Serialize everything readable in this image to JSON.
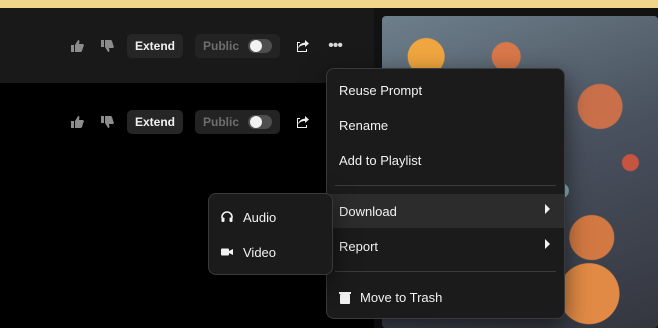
{
  "track_rows": [
    {
      "extend_label": "Extend",
      "public_label": "Public",
      "icons": {
        "like": "thumb-up-icon",
        "dislike": "thumb-down-icon",
        "share": "share-icon",
        "more": "more-icon"
      }
    },
    {
      "extend_label": "Extend",
      "public_label": "Public",
      "icons": {
        "like": "thumb-up-icon",
        "dislike": "thumb-down-icon",
        "share": "share-icon"
      }
    }
  ],
  "context_menu": {
    "items": [
      "Reuse Prompt",
      "Rename",
      "Add to Playlist",
      "Download",
      "Report",
      "Move to Trash"
    ],
    "trash_icon": "trash-icon",
    "submenu_indicator": "chevron-right-icon"
  },
  "download_submenu": {
    "items": [
      {
        "label": "Audio",
        "icon": "headphones-icon"
      },
      {
        "label": "Video",
        "icon": "video-camera-icon"
      }
    ]
  },
  "colors": {
    "top_accent": "#f1d58a",
    "menu_bg": "#1b1b1b",
    "hover_bg": "#2c2c2c"
  }
}
